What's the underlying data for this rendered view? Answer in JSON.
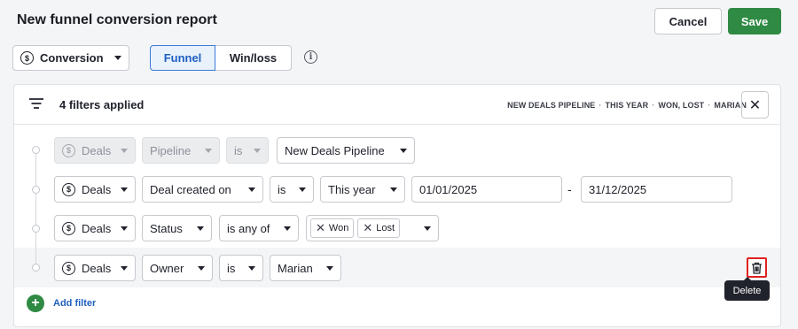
{
  "header": {
    "title": "New funnel conversion report",
    "cancel_label": "Cancel",
    "save_label": "Save",
    "colors": {
      "save": "#2f8a43",
      "accent": "#1f5fbf"
    }
  },
  "toolbar": {
    "metric_select": {
      "icon": "dollar-icon",
      "value": "Conversion"
    },
    "view_tabs": [
      {
        "label": "Funnel",
        "selected": true
      },
      {
        "label": "Win/loss",
        "selected": false
      }
    ],
    "info_icon": "info-icon"
  },
  "filters": {
    "count_label": "4 filters applied",
    "summary": [
      "NEW DEALS PIPELINE",
      "THIS YEAR",
      "WON, LOST",
      "MARIAN"
    ],
    "summary_separator": "·",
    "clear_icon": "close-icon",
    "rows": [
      {
        "entity": "Deals",
        "field": "Pipeline",
        "operator": "is",
        "value": "New Deals Pipeline",
        "disabled": true
      },
      {
        "entity": "Deals",
        "field": "Deal created on",
        "operator": "is",
        "value": "This year",
        "date_from": "01/01/2025",
        "date_to": "31/12/2025",
        "range_separator": "-"
      },
      {
        "entity": "Deals",
        "field": "Status",
        "operator": "is any of",
        "chips": [
          "Won",
          "Lost"
        ]
      },
      {
        "entity": "Deals",
        "field": "Owner",
        "operator": "is",
        "value": "Marian",
        "highlighted": true
      }
    ],
    "add_filter_label": "Add filter",
    "delete_tooltip": "Delete"
  }
}
